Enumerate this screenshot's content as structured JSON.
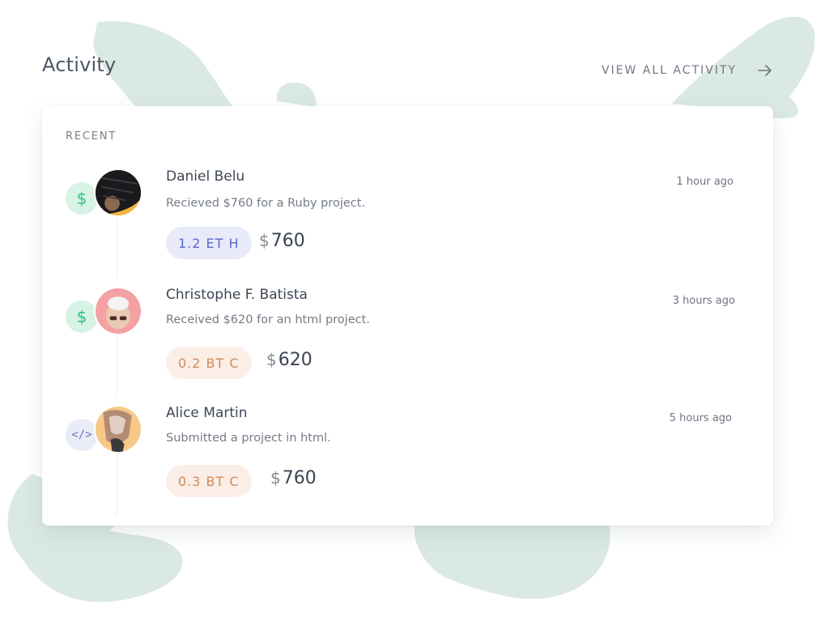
{
  "header": {
    "title": "Activity",
    "view_all_label": "VIEW ALL ACTIVITY",
    "view_all_icon": "arrow-right-icon"
  },
  "card": {
    "section_label": "RECENT"
  },
  "activities": [
    {
      "type_icon": "dollar-icon",
      "type_glyph": "$",
      "name": "Daniel Belu",
      "time": "1 hour ago",
      "description": "Recieved $760 for a Ruby project.",
      "crypto": "1.2 ET H",
      "currency_symbol": "$",
      "amount": "760"
    },
    {
      "type_icon": "dollar-icon",
      "type_glyph": "$",
      "name": "Christophe F. Batista",
      "time": "3 hours ago",
      "description": "Received  $620 for an html project.",
      "crypto": "0.2 BT C",
      "currency_symbol": "$",
      "amount": "620"
    },
    {
      "type_icon": "code-icon",
      "type_glyph": "</>",
      "name": "Alice Martin",
      "time": "5 hours ago",
      "description": "Submitted a project in html.",
      "crypto": "0.3 BT C",
      "currency_symbol": "$",
      "amount": "760"
    }
  ],
  "colors": {
    "blob": "#dbe9e3",
    "money_badge_bg": "#d6f3e6",
    "money_badge_fg": "#2fbf7f",
    "code_badge_bg": "#e9ecf7",
    "eth_pill_bg": "#e8eafa",
    "eth_pill_fg": "#5c68c9",
    "btc_pill_bg": "#fbeee6",
    "btc_pill_fg": "#d08a5c"
  }
}
